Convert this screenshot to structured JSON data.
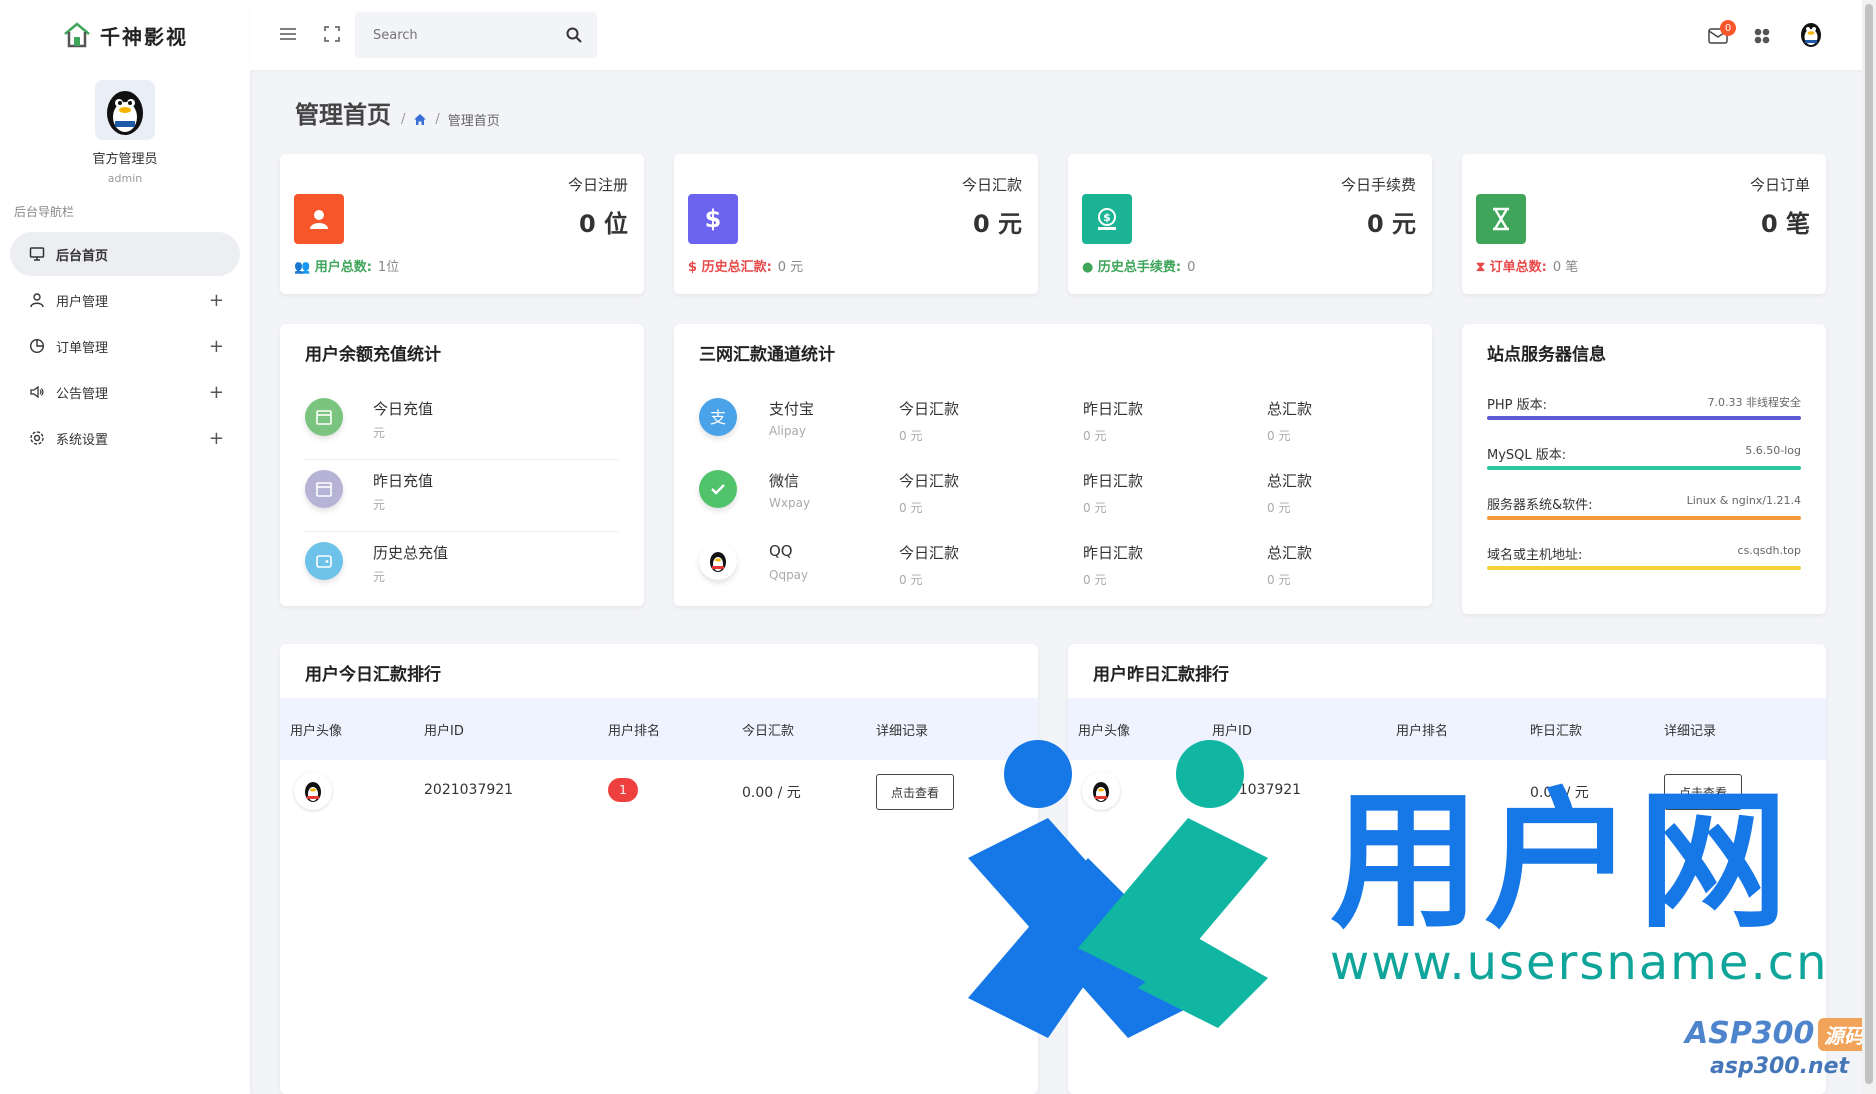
{
  "brand": {
    "name": "千神影视"
  },
  "profile": {
    "name": "官方管理员",
    "role": "admin"
  },
  "nav": {
    "title": "后台导航栏",
    "items": [
      {
        "label": "后台首页",
        "icon": "monitor-icon",
        "active": true
      },
      {
        "label": "用户管理",
        "icon": "user-icon"
      },
      {
        "label": "订单管理",
        "icon": "pie-chart-icon"
      },
      {
        "label": "公告管理",
        "icon": "speaker-icon"
      },
      {
        "label": "系统设置",
        "icon": "gear-icon"
      }
    ]
  },
  "topbar": {
    "search_placeholder": "Search",
    "mail_count": "0"
  },
  "page": {
    "title": "管理首页",
    "crumb": "管理首页"
  },
  "stats": [
    {
      "label": "今日注册",
      "value": "0 位",
      "foot_key": "用户总数:",
      "foot_value": "1位",
      "color": "#f7552a",
      "foot_color": "#3ea55a"
    },
    {
      "label": "今日汇款",
      "value": "0 元",
      "foot_key": "历史总汇款:",
      "foot_value": "0 元",
      "color": "#6c63f0",
      "foot_color": "#e84a4a"
    },
    {
      "label": "今日手续费",
      "value": "0 元",
      "foot_key": "历史总手续费:",
      "foot_value": "0",
      "color": "#1ab394",
      "foot_color": "#3ea55a"
    },
    {
      "label": "今日订单",
      "value": "0 笔",
      "foot_key": "订单总数:",
      "foot_value": "0 笔",
      "color": "#3ea55a",
      "foot_color": "#e84a4a"
    }
  ],
  "recharge": {
    "title": "用户余额充值统计",
    "rows": [
      {
        "label": "今日充值",
        "unit": "元"
      },
      {
        "label": "昨日充值",
        "unit": "元"
      },
      {
        "label": "历史总充值",
        "unit": "元"
      }
    ]
  },
  "channels": {
    "title": "三网汇款通道统计",
    "rows": [
      {
        "name": "支付宝",
        "sub": "Alipay",
        "today": "今日汇款",
        "today_v": "0 元",
        "yest": "昨日汇款",
        "yest_v": "0 元",
        "total": "总汇款",
        "total_v": "0 元"
      },
      {
        "name": "微信",
        "sub": "Wxpay",
        "today": "今日汇款",
        "today_v": "0 元",
        "yest": "昨日汇款",
        "yest_v": "0 元",
        "total": "总汇款",
        "total_v": "0 元"
      },
      {
        "name": "QQ",
        "sub": "Qqpay",
        "today": "今日汇款",
        "today_v": "0 元",
        "yest": "昨日汇款",
        "yest_v": "0 元",
        "total": "总汇款",
        "total_v": "0 元"
      }
    ]
  },
  "server": {
    "title": "站点服务器信息",
    "rows": [
      {
        "key": "PHP 版本:",
        "value": "7.0.33 非线程安全",
        "color": "#5b5bd6"
      },
      {
        "key": "MySQL 版本:",
        "value": "5.6.50-log",
        "color": "#2cc7a0"
      },
      {
        "key": "服务器系统&软件:",
        "value": "Linux & nginx/1.21.4",
        "color": "#f39b3b"
      },
      {
        "key": "域名或主机地址:",
        "value": "cs.qsdh.top",
        "color": "#f5d23a"
      }
    ]
  },
  "rank_today": {
    "title": "用户今日汇款排行",
    "headers": [
      "用户头像",
      "用户ID",
      "用户排名",
      "今日汇款",
      "详细记录"
    ],
    "row": {
      "id": "2021037921",
      "rank": "1",
      "amount": "0.00 / 元",
      "button": "点击查看"
    }
  },
  "rank_yesterday": {
    "title": "用户昨日汇款排行",
    "headers": [
      "用户头像",
      "用户ID",
      "用户排名",
      "昨日汇款",
      "详细记录"
    ],
    "row": {
      "id": "2021037921",
      "amount": "0.00 / 元",
      "button": "点击查看"
    }
  },
  "watermark": {
    "big": "用户网",
    "url": "www.usersname.cn",
    "asp": "ASP300",
    "asp_tag": "源码",
    "asp_url": "asp300.net"
  }
}
